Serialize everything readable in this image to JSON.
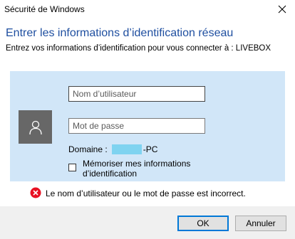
{
  "window": {
    "title": "Sécurité de Windows",
    "close_icon": "close-icon"
  },
  "header": {
    "title": "Entrer les informations d’identification réseau",
    "subtitle": "Entrez vos informations d’identification pour vous connecter à : LIVEBOX"
  },
  "form": {
    "avatar_icon": "user-icon",
    "username": {
      "placeholder": "Nom d’utilisateur",
      "value": ""
    },
    "password": {
      "placeholder": "Mot de passe",
      "value": ""
    },
    "domain_label": "Domaine :",
    "domain_suffix": "-PC",
    "remember": {
      "label": "Mémoriser mes informations d’identification",
      "checked": false
    }
  },
  "error": {
    "icon": "error-icon",
    "message": "Le nom d’utilisateur ou le mot de passe est incorrect."
  },
  "buttons": {
    "ok": "OK",
    "cancel": "Annuler"
  },
  "colors": {
    "title_blue": "#1f4fa0",
    "panel_bg": "#d1e6f8",
    "avatar_bg": "#676767",
    "error_red": "#e81123",
    "focus_blue": "#0078d7"
  }
}
